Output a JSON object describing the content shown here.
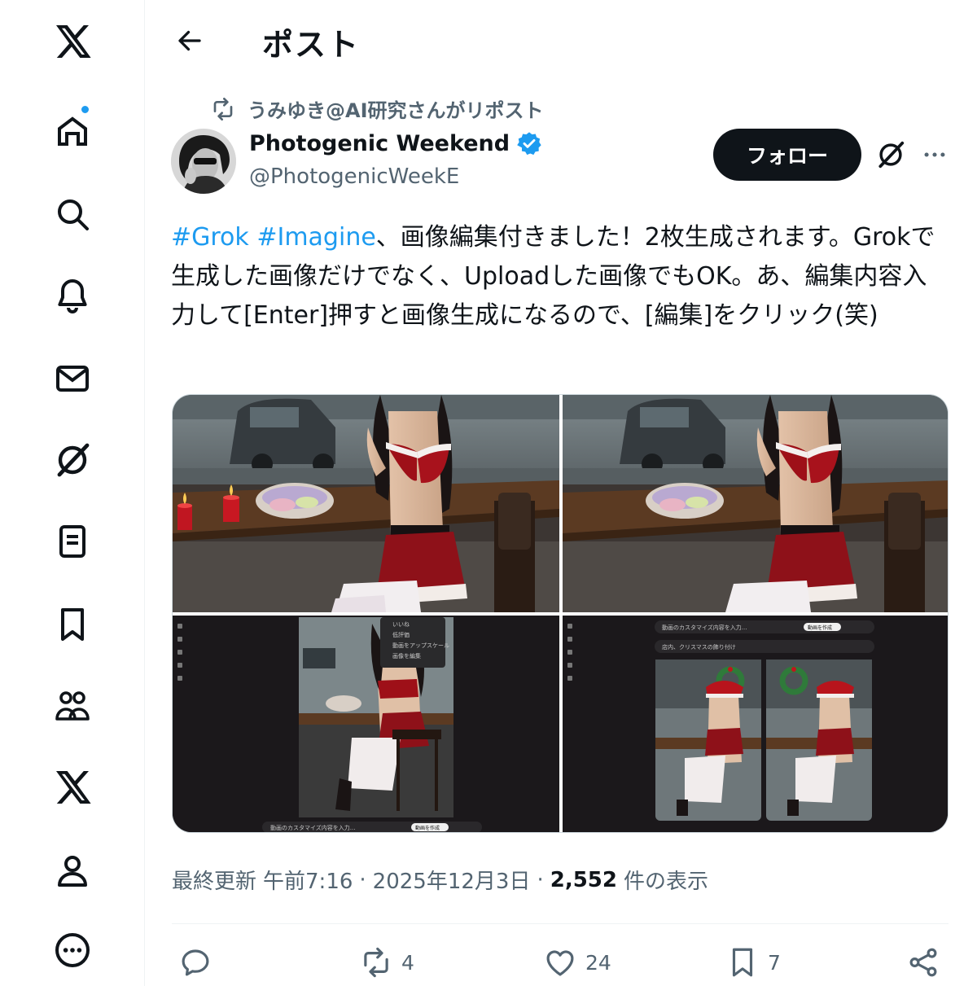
{
  "nav": {
    "items": [
      {
        "icon": "x-logo-icon"
      },
      {
        "icon": "home-icon",
        "has_notification_dot": true
      },
      {
        "icon": "search-icon"
      },
      {
        "icon": "bell-icon"
      },
      {
        "icon": "mail-icon"
      },
      {
        "icon": "grok-icon"
      },
      {
        "icon": "list-icon"
      },
      {
        "icon": "bookmark-icon"
      },
      {
        "icon": "communities-icon"
      },
      {
        "icon": "x-premium-icon"
      },
      {
        "icon": "profile-icon"
      },
      {
        "icon": "more-circle-icon"
      }
    ]
  },
  "header": {
    "title": "ポスト"
  },
  "post": {
    "repost_by": "うみゆき@AI研究さんがリポスト",
    "author": {
      "display_name": "Photogenic Weekend",
      "handle": "@PhotogenicWeekE",
      "verified": true
    },
    "follow_label": "フォロー",
    "text": {
      "hashtag1": "#Grok",
      "hashtag2": "#Imagine",
      "body": "、画像編集付きました！2枚生成されます。Grokで生成した画像だけでなく、Uploadした画像でもOK。あ、編集内容入力して[Enter]押すと画像生成になるので、[編集]をクリック(笑)"
    },
    "media": {
      "screenshot_left": {
        "menu_items": [
          "いいね",
          "低評価",
          "動画をアップスケール",
          "画像を編集"
        ],
        "prompt_placeholder": "動画のカスタマイズ内容を入力...",
        "create_button": "動画を作成"
      },
      "screenshot_right": {
        "prompt_placeholder": "動画のカスタマイズ内容を入力...",
        "create_button": "動画を作成",
        "edit_chip": "店内、クリスマスの飾り付け"
      }
    },
    "meta": {
      "updated_label": "最終更新",
      "time": "午前7:16",
      "date": "2025年12月3日",
      "views_count": "2,552",
      "views_label": "件の表示",
      "separator": "·"
    },
    "actions": {
      "reply_count": "",
      "repost_count": "4",
      "like_count": "24",
      "bookmark_count": "7"
    }
  },
  "colors": {
    "accent": "#1d9bf0",
    "text_primary": "#0f1419",
    "text_secondary": "#536471",
    "follow_bg": "#0f1419"
  }
}
